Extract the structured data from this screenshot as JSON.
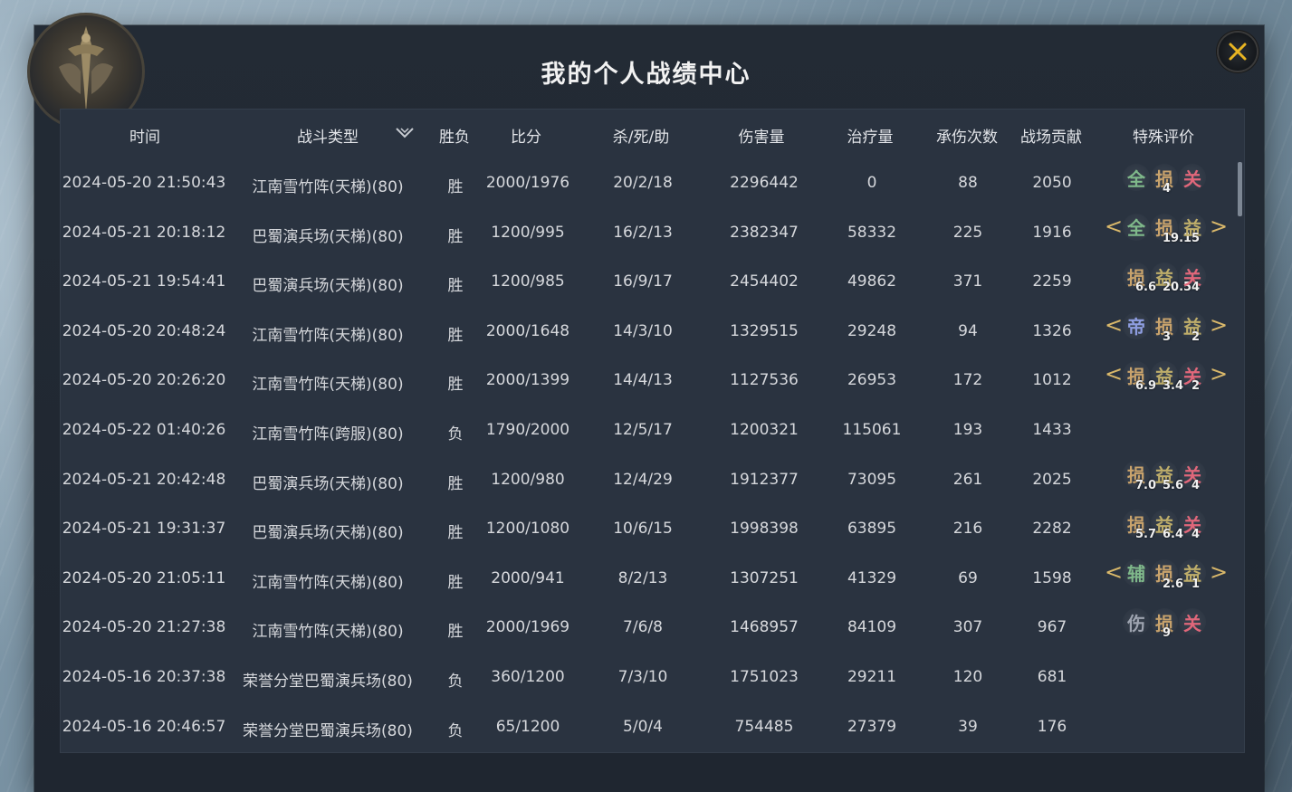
{
  "window": {
    "title": "我的个人战绩中心"
  },
  "columns": [
    "时间",
    "战斗类型",
    "胜负",
    "比分",
    "杀/死/助",
    "伤害量",
    "治疗量",
    "承伤次数",
    "战场贡献",
    "特殊评价"
  ],
  "colors": {
    "panel_bg": "#232b35",
    "table_bg": "#2a3340",
    "close_x": "#e8b422",
    "bracket": "#d9b86a"
  },
  "badge_colors": {
    "全": "#7fb88a",
    "损": "#c9a36c",
    "关": "#e0677a",
    "益": "#bfae6a",
    "帝": "#8e9de0",
    "辅": "#7fb88a",
    "伤": "#9ea4b0"
  },
  "rows": [
    {
      "time": "2024-05-20 21:50:43",
      "type": "江南雪竹阵(天梯)(80)",
      "result": "胜",
      "score": "2000/1976",
      "kda": "20/2/18",
      "damage": "2296442",
      "heal": "0",
      "hits": "88",
      "contrib": "2050",
      "badges": [
        "全",
        "损",
        "关"
      ],
      "nums": [
        "",
        "4",
        ""
      ],
      "bracket": false
    },
    {
      "time": "2024-05-21 20:18:12",
      "type": "巴蜀演兵场(天梯)(80)",
      "result": "胜",
      "score": "1200/995",
      "kda": "16/2/13",
      "damage": "2382347",
      "heal": "58332",
      "hits": "225",
      "contrib": "1916",
      "badges": [
        "全",
        "损",
        "益"
      ],
      "nums": [
        "",
        "19.1",
        "5"
      ],
      "bracket": true
    },
    {
      "time": "2024-05-21 19:54:41",
      "type": "巴蜀演兵场(天梯)(80)",
      "result": "胜",
      "score": "1200/985",
      "kda": "16/9/17",
      "damage": "2454402",
      "heal": "49862",
      "hits": "371",
      "contrib": "2259",
      "badges": [
        "损",
        "益",
        "关"
      ],
      "nums": [
        "6.6",
        "20.5",
        "4"
      ],
      "bracket": false
    },
    {
      "time": "2024-05-20 20:48:24",
      "type": "江南雪竹阵(天梯)(80)",
      "result": "胜",
      "score": "2000/1648",
      "kda": "14/3/10",
      "damage": "1329515",
      "heal": "29248",
      "hits": "94",
      "contrib": "1326",
      "badges": [
        "帝",
        "损",
        "益"
      ],
      "nums": [
        "",
        "3",
        "2"
      ],
      "bracket": true
    },
    {
      "time": "2024-05-20 20:26:20",
      "type": "江南雪竹阵(天梯)(80)",
      "result": "胜",
      "score": "2000/1399",
      "kda": "14/4/13",
      "damage": "1127536",
      "heal": "26953",
      "hits": "172",
      "contrib": "1012",
      "badges": [
        "损",
        "益",
        "关"
      ],
      "nums": [
        "6.9",
        "3.4",
        "2"
      ],
      "bracket": true
    },
    {
      "time": "2024-05-22 01:40:26",
      "type": "江南雪竹阵(跨服)(80)",
      "result": "负",
      "score": "1790/2000",
      "kda": "12/5/17",
      "damage": "1200321",
      "heal": "115061",
      "hits": "193",
      "contrib": "1433",
      "badges": [],
      "nums": [],
      "bracket": false
    },
    {
      "time": "2024-05-21 20:42:48",
      "type": "巴蜀演兵场(天梯)(80)",
      "result": "胜",
      "score": "1200/980",
      "kda": "12/4/29",
      "damage": "1912377",
      "heal": "73095",
      "hits": "261",
      "contrib": "2025",
      "badges": [
        "损",
        "益",
        "关"
      ],
      "nums": [
        "7.0",
        "5.6",
        "4"
      ],
      "bracket": false
    },
    {
      "time": "2024-05-21 19:31:37",
      "type": "巴蜀演兵场(天梯)(80)",
      "result": "胜",
      "score": "1200/1080",
      "kda": "10/6/15",
      "damage": "1998398",
      "heal": "63895",
      "hits": "216",
      "contrib": "2282",
      "badges": [
        "损",
        "益",
        "关"
      ],
      "nums": [
        "5.7",
        "6.4",
        "4"
      ],
      "bracket": false
    },
    {
      "time": "2024-05-20 21:05:11",
      "type": "江南雪竹阵(天梯)(80)",
      "result": "胜",
      "score": "2000/941",
      "kda": "8/2/13",
      "damage": "1307251",
      "heal": "41329",
      "hits": "69",
      "contrib": "1598",
      "badges": [
        "辅",
        "损",
        "益"
      ],
      "nums": [
        "",
        "2.6",
        "1"
      ],
      "bracket": true
    },
    {
      "time": "2024-05-20 21:27:38",
      "type": "江南雪竹阵(天梯)(80)",
      "result": "胜",
      "score": "2000/1969",
      "kda": "7/6/8",
      "damage": "1468957",
      "heal": "84109",
      "hits": "307",
      "contrib": "967",
      "badges": [
        "伤",
        "损",
        "关"
      ],
      "nums": [
        "",
        "9",
        ""
      ],
      "bracket": false
    },
    {
      "time": "2024-05-16 20:37:38",
      "type": "荣誉分堂巴蜀演兵场(80)",
      "result": "负",
      "score": "360/1200",
      "kda": "7/3/10",
      "damage": "1751023",
      "heal": "29211",
      "hits": "120",
      "contrib": "681",
      "badges": [],
      "nums": [],
      "bracket": false
    },
    {
      "time": "2024-05-16 20:46:57",
      "type": "荣誉分堂巴蜀演兵场(80)",
      "result": "负",
      "score": "65/1200",
      "kda": "5/0/4",
      "damage": "754485",
      "heal": "27379",
      "hits": "39",
      "contrib": "176",
      "badges": [],
      "nums": [],
      "bracket": false
    }
  ]
}
